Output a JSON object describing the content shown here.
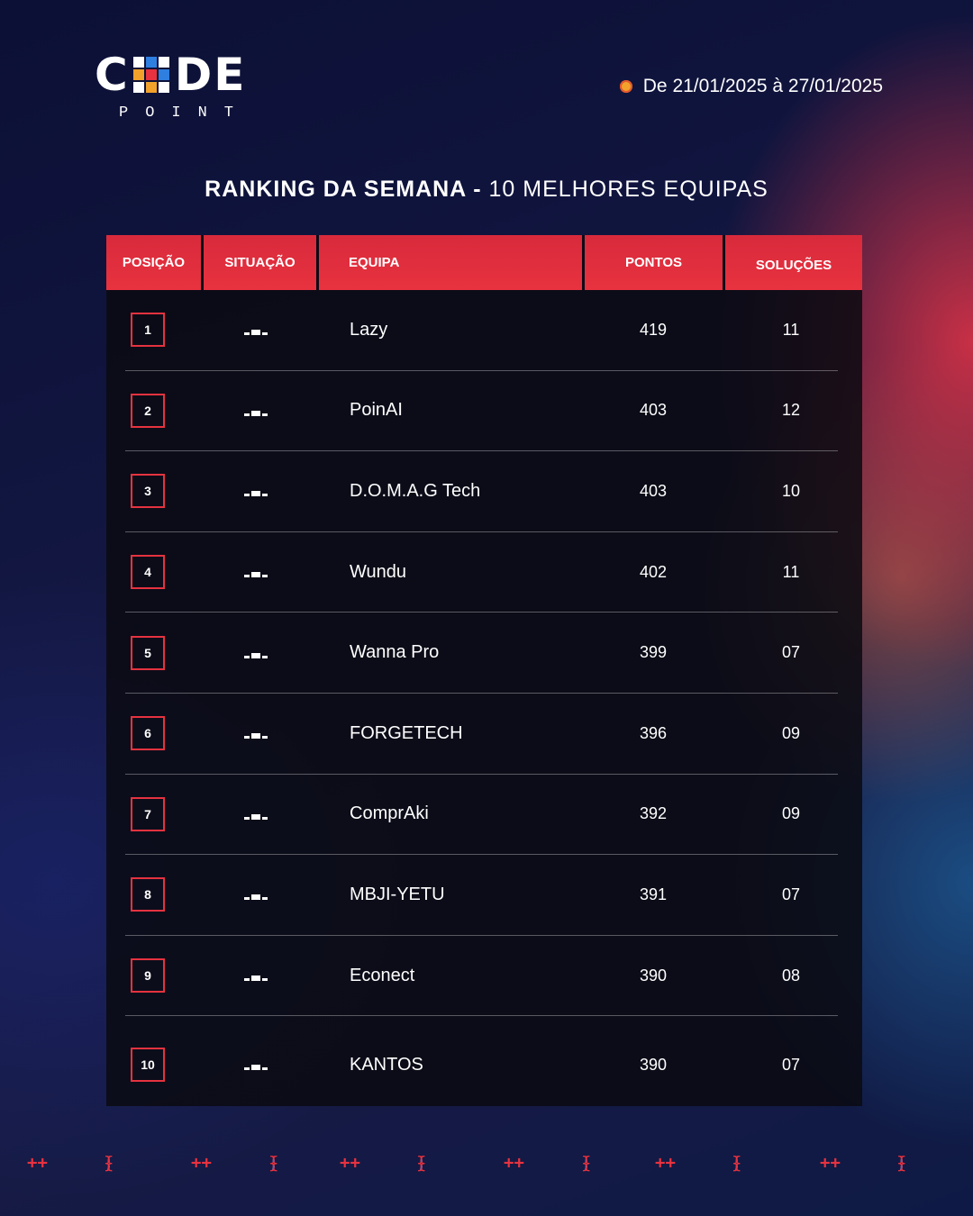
{
  "brand": {
    "logo_c": "C",
    "logo_de": "DE",
    "logo_sub": "POINT",
    "logo_grid_colors": [
      "#ffffff",
      "#2f7fe0",
      "#ffffff",
      "#f2a22b",
      "#e8323f",
      "#2f7fe0",
      "#ffffff",
      "#f2a22b",
      "#ffffff"
    ]
  },
  "date_range": "De 21/01/2025 à 27/01/2025",
  "title": {
    "strong": "RANKING DA SEMANA - ",
    "light": "10 MELHORES EQUIPAS"
  },
  "columns": [
    "POSIÇÃO",
    "SITUAÇÃO",
    "EQUIPA",
    "PONTOS",
    "SOLUÇÕES"
  ],
  "status_icon": "unchanged-icon",
  "rows": [
    {
      "pos": "1",
      "team": "Lazy",
      "points": "419",
      "solutions": "11"
    },
    {
      "pos": "2",
      "team": "PoinAI",
      "points": "403",
      "solutions": "12"
    },
    {
      "pos": "3",
      "team": "D.O.M.A.G Tech",
      "points": "403",
      "solutions": "10"
    },
    {
      "pos": "4",
      "team": "Wundu",
      "points": "402",
      "solutions": "11"
    },
    {
      "pos": "5",
      "team": "Wanna Pro",
      "points": "399",
      "solutions": "07"
    },
    {
      "pos": "6",
      "team": "FORGETECH",
      "points": "396",
      "solutions": "09"
    },
    {
      "pos": "7",
      "team": "ComprAki",
      "points": "392",
      "solutions": "09"
    },
    {
      "pos": "8",
      "team": "MBJI-YETU",
      "points": "391",
      "solutions": "07"
    },
    {
      "pos": "9",
      "team": "Econect",
      "points": "390",
      "solutions": "08"
    },
    {
      "pos": "10",
      "team": "KANTOS",
      "points": "390",
      "solutions": "07"
    }
  ],
  "footer": {
    "plus": "++",
    "brace_open": "{",
    "brace_semi": ";",
    "brace_close": "}",
    "colors": {
      "plus": "#e8323f",
      "semicolon": "#2f7fe0"
    }
  },
  "colors": {
    "accent": "#e8323f",
    "date_dot": "#f2a22b"
  }
}
